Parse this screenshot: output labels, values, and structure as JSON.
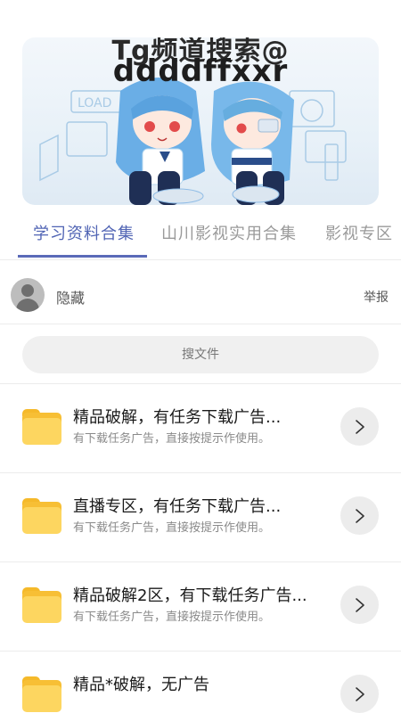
{
  "banner": {
    "line1": "Tg频道搜索@",
    "line2": "ddddffxxr",
    "watermark": "LOAD"
  },
  "tabs": [
    {
      "label": "学习资料合集",
      "active": true
    },
    {
      "label": "山川影视实用合集",
      "active": false
    },
    {
      "label": "影视专区",
      "active": false
    }
  ],
  "owner": {
    "name": "隐藏",
    "report_label": "举报"
  },
  "search": {
    "placeholder": "搜文件"
  },
  "files": [
    {
      "title": "精品破解，有任务下载广告...",
      "desc": "有下载任务广告，直接按提示作使用。"
    },
    {
      "title": "直播专区，有任务下载广告...",
      "desc": "有下载任务广告，直接按提示作使用。"
    },
    {
      "title": "精品破解2区，有下载任务广告...",
      "desc": "有下载任务广告，直接按提示作使用。"
    },
    {
      "title": "精品*破解，无广告",
      "desc": ""
    }
  ],
  "colors": {
    "accent": "#5064b4",
    "folder": "#fdd660"
  },
  "icons": {
    "avatar": "user-avatar-icon",
    "folder": "folder-icon",
    "chevron": "chevron-right-icon"
  }
}
